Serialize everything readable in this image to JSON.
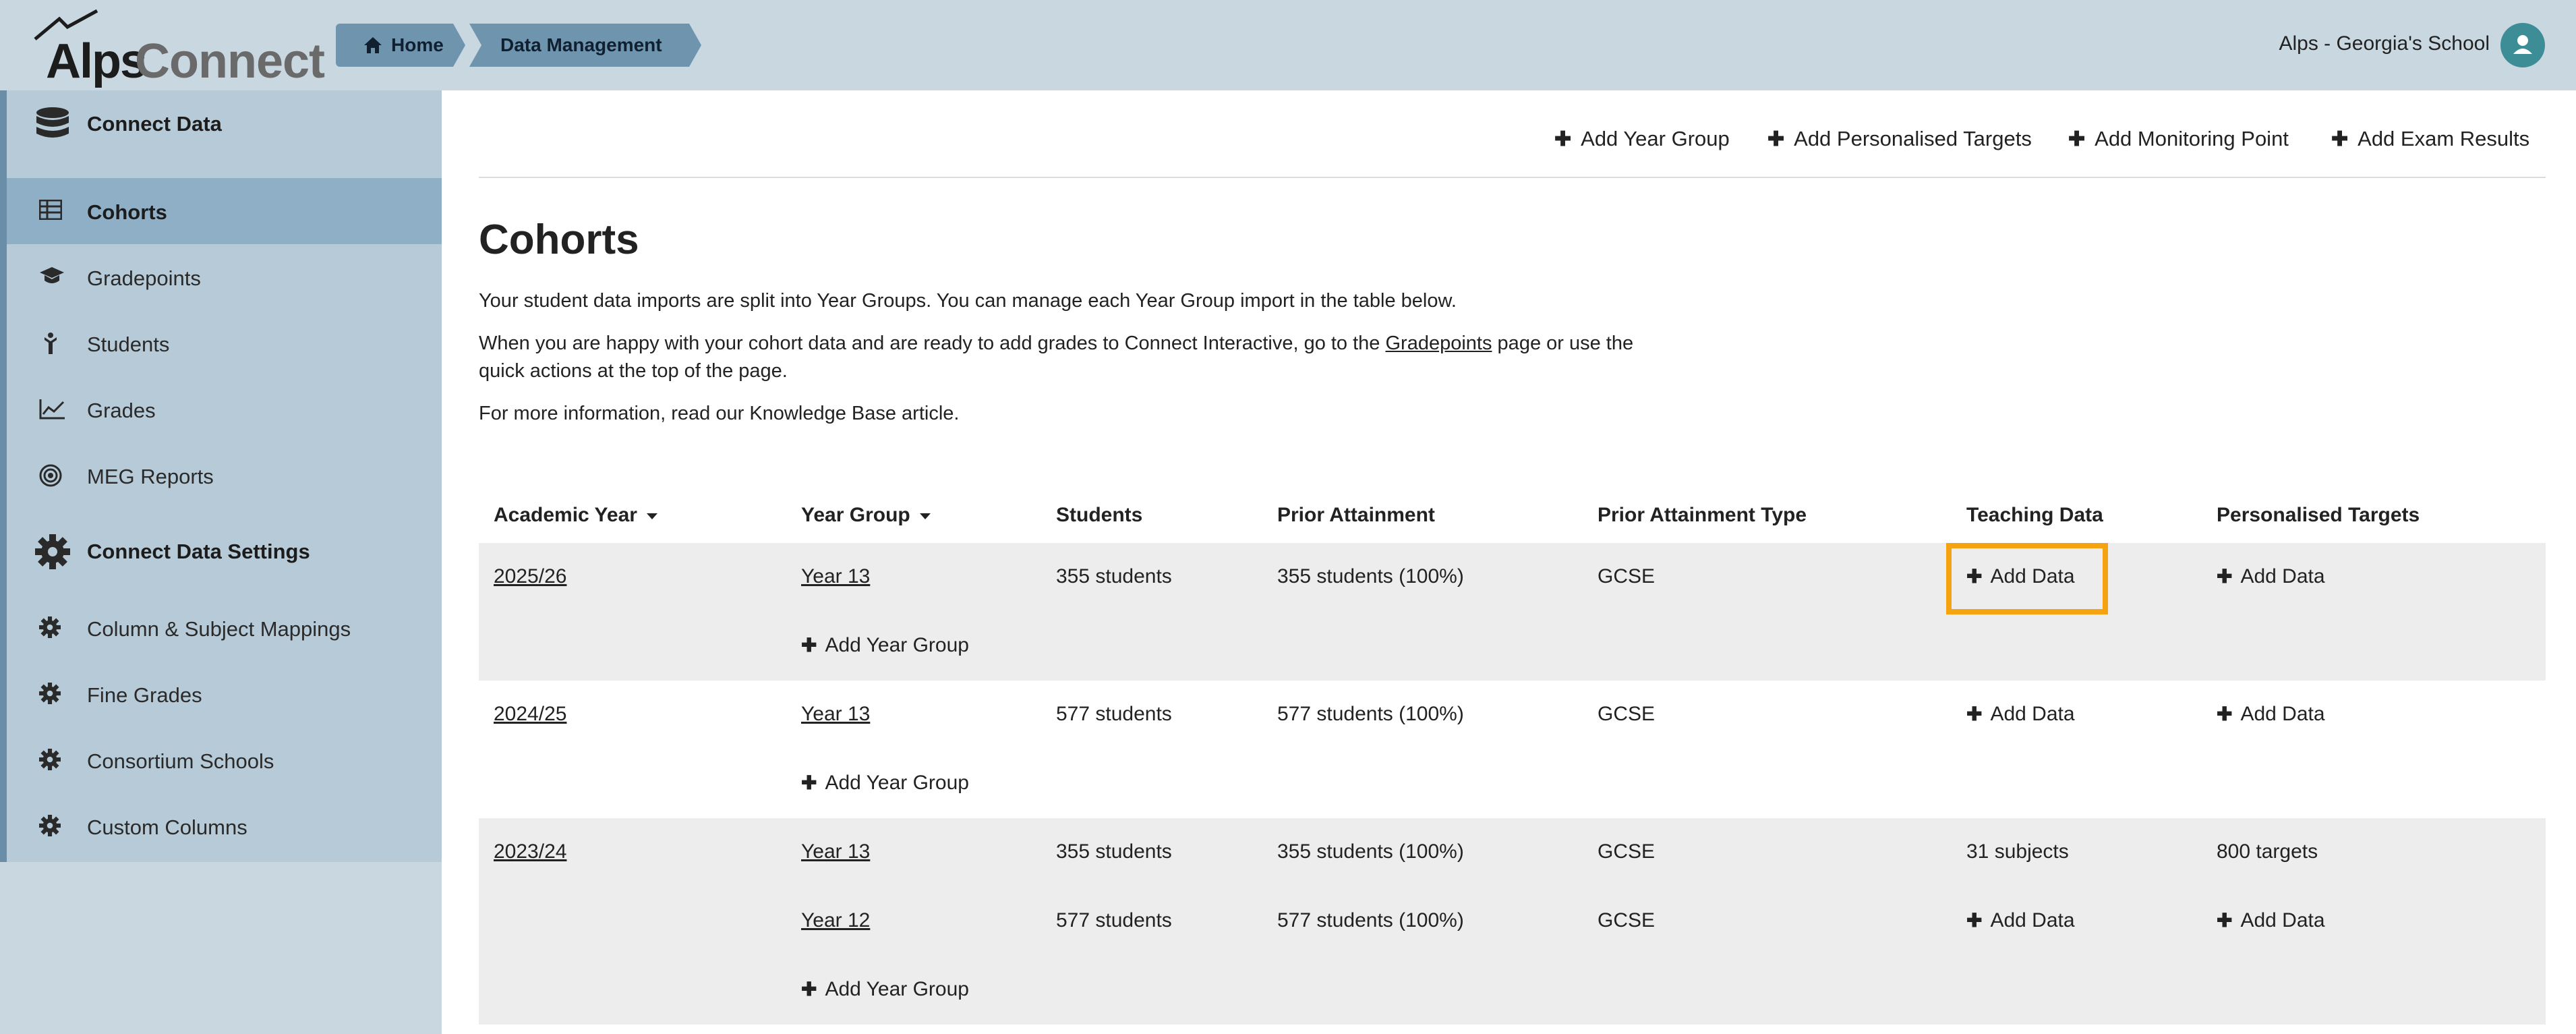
{
  "app": {
    "logo_primary": "Alps",
    "logo_secondary": "Connect",
    "school_name": "Alps - Georgia's School",
    "accent_color": "#6f94ae",
    "highlight_color": "#f5a310"
  },
  "breadcrumb": [
    {
      "label": "Home",
      "icon": "home-icon"
    },
    {
      "label": "Data Management"
    }
  ],
  "sidebar": {
    "section1": {
      "label": "Connect Data",
      "icon": "database-icon"
    },
    "items1": [
      {
        "label": "Cohorts",
        "icon": "table-icon",
        "active": true
      },
      {
        "label": "Gradepoints",
        "icon": "graduation-cap-icon"
      },
      {
        "label": "Students",
        "icon": "student-icon"
      },
      {
        "label": "Grades",
        "icon": "line-chart-icon"
      },
      {
        "label": "MEG Reports",
        "icon": "target-icon"
      }
    ],
    "section2": {
      "label": "Connect Data Settings",
      "icon": "gear-icon"
    },
    "items2": [
      {
        "label": "Column & Subject Mappings",
        "icon": "gear-icon"
      },
      {
        "label": "Fine Grades",
        "icon": "gear-icon"
      },
      {
        "label": "Consortium Schools",
        "icon": "gear-icon"
      },
      {
        "label": "Custom Columns",
        "icon": "gear-icon"
      }
    ]
  },
  "actions": [
    {
      "label": "Add Year Group"
    },
    {
      "label": "Add Personalised Targets"
    },
    {
      "label": "Add Monitoring Point"
    },
    {
      "label": "Add Exam Results"
    }
  ],
  "page": {
    "title": "Cohorts",
    "intro": "Your student data imports are split into Year Groups. You can manage each Year Group import in the table below.",
    "para2_before": "When you are happy with your cohort data and are ready to add grades to Connect Interactive, go to the ",
    "para2_link": "Gradepoints",
    "para2_after": " page or use the quick actions at the top of the page.",
    "para3": "For more information, read our Knowledge Base article."
  },
  "table": {
    "headers": {
      "academic_year": "Academic Year",
      "year_group": "Year Group",
      "students": "Students",
      "prior_attainment": "Prior Attainment",
      "prior_attainment_type": "Prior Attainment Type",
      "teaching_data": "Teaching Data",
      "personalised_targets": "Personalised Targets"
    },
    "add_data_label": "Add Data",
    "add_year_group_label": "Add Year Group",
    "groups": [
      {
        "academic_year": "2025/26",
        "rows": [
          {
            "year_group": "Year 13",
            "students": "355 students",
            "prior_attainment": "355 students (100%)",
            "prior_attainment_type": "GCSE",
            "teaching_data": "",
            "personalised_targets": ""
          }
        ]
      },
      {
        "academic_year": "2024/25",
        "rows": [
          {
            "year_group": "Year 13",
            "students": "577 students",
            "prior_attainment": "577 students (100%)",
            "prior_attainment_type": "GCSE",
            "teaching_data": "",
            "personalised_targets": ""
          }
        ]
      },
      {
        "academic_year": "2023/24",
        "rows": [
          {
            "year_group": "Year 13",
            "students": "355 students",
            "prior_attainment": "355 students (100%)",
            "prior_attainment_type": "GCSE",
            "teaching_data": "31 subjects",
            "personalised_targets": "800 targets"
          },
          {
            "year_group": "Year 12",
            "students": "577 students",
            "prior_attainment": "577 students (100%)",
            "prior_attainment_type": "GCSE",
            "teaching_data": "",
            "personalised_targets": ""
          }
        ]
      }
    ]
  }
}
